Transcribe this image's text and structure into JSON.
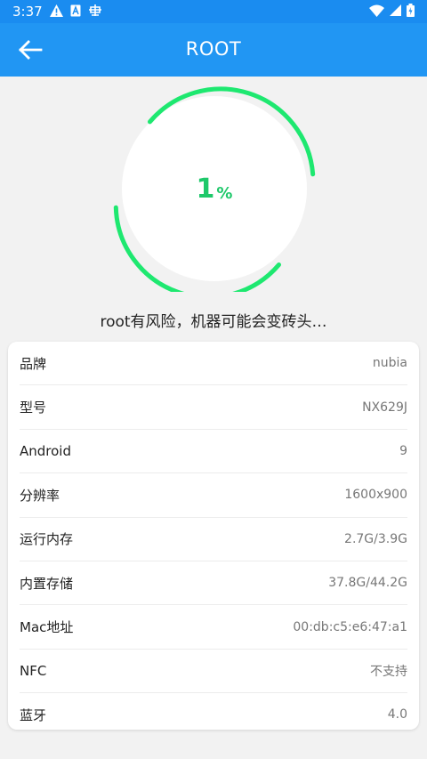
{
  "status_bar": {
    "time": "3:37",
    "left_icons": [
      "warning-icon",
      "a-box-icon",
      "bug-icon"
    ],
    "right_icons": [
      "wifi-icon",
      "signal-icon",
      "battery-icon"
    ]
  },
  "app_bar": {
    "title": "ROOT",
    "back_icon": "arrow-left-icon",
    "background": "#2196f3"
  },
  "progress": {
    "value": "1",
    "unit": "%",
    "color": "#1ee870"
  },
  "warning_text": "root有风险，机器可能会变砖头…",
  "device_info": [
    {
      "label": "品牌",
      "value": "nubia"
    },
    {
      "label": "型号",
      "value": "NX629J"
    },
    {
      "label": "Android",
      "value": "9"
    },
    {
      "label": "分辨率",
      "value": "1600x900"
    },
    {
      "label": "运行内存",
      "value": "2.7G/3.9G"
    },
    {
      "label": "内置存储",
      "value": "37.8G/44.2G"
    },
    {
      "label": "Mac地址",
      "value": "00:db:c5:e6:47:a1"
    },
    {
      "label": "NFC",
      "value": "不支持"
    },
    {
      "label": "蓝牙",
      "value": "4.0"
    }
  ]
}
